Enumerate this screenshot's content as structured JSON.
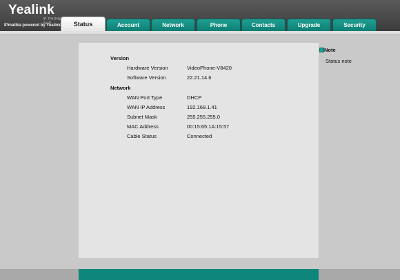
{
  "brand": {
    "logo_text": "Yealink",
    "logo_subtext": "IP PHONE VoIP",
    "tagline": "IPmatika powered by Yealink"
  },
  "nav": {
    "tabs": [
      {
        "label": "Status",
        "active": true
      },
      {
        "label": "Account",
        "active": false
      },
      {
        "label": "Network",
        "active": false
      },
      {
        "label": "Phone",
        "active": false
      },
      {
        "label": "Contacts",
        "active": false
      },
      {
        "label": "Upgrade",
        "active": false
      },
      {
        "label": "Security",
        "active": false
      }
    ]
  },
  "status": {
    "version_heading": "Version",
    "version_rows": [
      {
        "label": "Hardware Version",
        "value": "VideoPhone-V8420"
      },
      {
        "label": "Software Version",
        "value": "22.21.14.6"
      }
    ],
    "network_heading": "Network",
    "network_rows": [
      {
        "label": "WAN Port Type",
        "value": "DHCP"
      },
      {
        "label": "WAN IP Address",
        "value": "192.168.1.41"
      },
      {
        "label": "Subnet Mask",
        "value": "255.255.255.0"
      },
      {
        "label": "MAC Address",
        "value": "00:15:65:1A:15:57"
      },
      {
        "label": "Cable Status",
        "value": "Connected"
      }
    ]
  },
  "note": {
    "title": "Note",
    "text": "Status note"
  },
  "colors": {
    "tab_teal": "#0d7f74",
    "header_gray": "#4a4a4a",
    "panel_bg": "#e4e4e4",
    "page_bg": "#c9c9c9"
  }
}
